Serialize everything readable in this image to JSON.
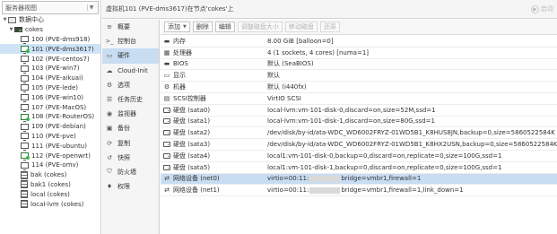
{
  "tree": {
    "view_selector": "服务器视图",
    "datacenter": "数据中心",
    "node": "cokes",
    "vms": [
      {
        "label": "100 (PVE-dms918)",
        "running": false
      },
      {
        "label": "101 (PVE-dms3617)",
        "running": true,
        "selected": true
      },
      {
        "label": "102 (PVE-centos7)",
        "running": false
      },
      {
        "label": "103 (PVE-win7)",
        "running": false
      },
      {
        "label": "104 (PVE-aikuai)",
        "running": false
      },
      {
        "label": "105 (PVE-lede)",
        "running": false
      },
      {
        "label": "106 (PVE-win10)",
        "running": false
      },
      {
        "label": "107 (PVE-MacOS)",
        "running": false
      },
      {
        "label": "108 (PVE-RouterOS)",
        "running": true
      },
      {
        "label": "109 (PVE-debian)",
        "running": false
      },
      {
        "label": "110 (PVE-pve)",
        "running": false
      },
      {
        "label": "111 (PVE-ubuntu)",
        "running": false
      },
      {
        "label": "112 (PVE-openwrt)",
        "running": true
      },
      {
        "label": "114 (PVE-omv)",
        "running": false
      }
    ],
    "storages": [
      "bak (cokes)",
      "bak1 (cokes)",
      "local (cokes)",
      "local-lvm (cokes)"
    ]
  },
  "header": {
    "title": "虚拟机101 (PVE-dms3617)在节点'cokes'上",
    "start_label": "启动"
  },
  "menu": [
    {
      "label": "概要",
      "icon": "≡"
    },
    {
      "label": "控制台",
      "icon": ">_"
    },
    {
      "label": "硬件",
      "icon": "▭",
      "selected": true
    },
    {
      "label": "Cloud-Init",
      "icon": "☁"
    },
    {
      "label": "选项",
      "icon": "⚙"
    },
    {
      "label": "任务历史",
      "icon": "☰"
    },
    {
      "label": "监视器",
      "icon": "◉"
    },
    {
      "label": "备份",
      "icon": "▣"
    },
    {
      "label": "复制",
      "icon": "⟳"
    },
    {
      "label": "快照",
      "icon": "↺"
    },
    {
      "label": "防火墙",
      "icon": "⛉"
    },
    {
      "label": "权限",
      "icon": "♦"
    }
  ],
  "toolbar": {
    "add": "添加",
    "remove": "删除",
    "edit": "编辑",
    "resize": "调整磁盘大小",
    "move": "移动磁盘",
    "revert": "还原"
  },
  "hardware": [
    {
      "icon": "▬",
      "name": "内存",
      "value": "8.00 GiB [balloon=0]"
    },
    {
      "icon": "▦",
      "name": "处理器",
      "value": "4 (1 sockets, 4 cores) [numa=1]"
    },
    {
      "icon": "▬",
      "name": "BIOS",
      "value": "默认 (SeaBIOS)"
    },
    {
      "icon": "▭",
      "name": "显示",
      "value": "默认"
    },
    {
      "icon": "⚙",
      "name": "机器",
      "value": "默认 (i440fx)"
    },
    {
      "icon": "▤",
      "name": "SCSI控制器",
      "value": "VirtIO SCSI"
    },
    {
      "icon": "disk",
      "name": "硬盘 (sata0)",
      "value": "local-lvm:vm-101-disk-0,discard=on,size=52M,ssd=1"
    },
    {
      "icon": "disk",
      "name": "硬盘 (sata1)",
      "value": "local-lvm:vm-101-disk-1,discard=on,size=80G,ssd=1"
    },
    {
      "icon": "disk",
      "name": "硬盘 (sata2)",
      "value": "/dev/disk/by-id/ata-WDC_WD6002FRYZ-01WD5B1_K8HUS8JN,backup=0,size=5860522584K"
    },
    {
      "icon": "disk",
      "name": "硬盘 (sata3)",
      "value": "/dev/disk/by-id/ata-WDC_WD6002FRYZ-01WD5B1_K8HX2USN,backup=0,size=5860522584K"
    },
    {
      "icon": "disk",
      "name": "硬盘 (sata4)",
      "value": "local1:vm-101-disk-0,backup=0,discard=on,replicate=0,size=100G,ssd=1"
    },
    {
      "icon": "disk",
      "name": "硬盘 (sata5)",
      "value": "local1:vm-101-disk-1,backup=0,discard=on,replicate=0,size=100G,ssd=1"
    },
    {
      "icon": "⇄",
      "name": "网络设备 (net0)",
      "value_prefix": "virtio=00:11:",
      "value_suffix": "bridge=vmbr1,firewall=1",
      "selected": true
    },
    {
      "icon": "⇄",
      "name": "网络设备 (net1)",
      "value_prefix": "virtio=00:11:",
      "value_suffix": "bridge=vmbr1,firewall=1,link_down=1"
    }
  ],
  "colors": {
    "selection": "#c8dcf2",
    "running": "#3cb44b"
  }
}
